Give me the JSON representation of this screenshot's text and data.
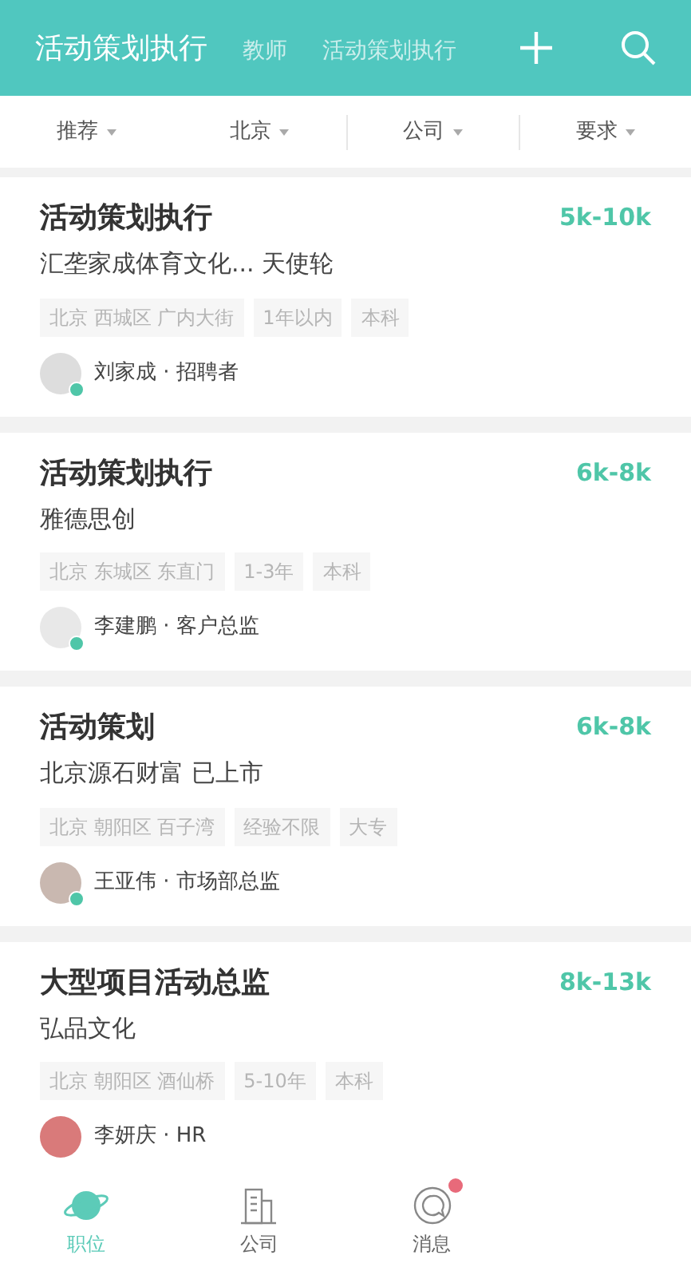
{
  "header": {
    "tabs": [
      {
        "label": "活动策划执行",
        "selected": true
      },
      {
        "label": "教师",
        "selected": false
      },
      {
        "label": "活动策划执行",
        "selected": false
      }
    ]
  },
  "filters": [
    {
      "label": "推荐"
    },
    {
      "label": "北京"
    },
    {
      "label": "公司"
    },
    {
      "label": "要求"
    }
  ],
  "jobs": [
    {
      "title": "活动策划执行",
      "salary": "5k-10k",
      "company": "汇垄家成体育文化... 天使轮",
      "tags": [
        "北京 西城区 广内大街",
        "1年以内",
        "本科"
      ],
      "recruiter": "刘家成 · 招聘者",
      "verified": true
    },
    {
      "title": "活动策划执行",
      "salary": "6k-8k",
      "company": "雅德思创",
      "tags": [
        "北京 东城区 东直门",
        "1-3年",
        "本科"
      ],
      "recruiter": "李建鹏 · 客户总监",
      "verified": true
    },
    {
      "title": "活动策划",
      "salary": "6k-8k",
      "company": "北京源石财富 已上市",
      "tags": [
        "北京 朝阳区 百子湾",
        "经验不限",
        "大专"
      ],
      "recruiter": "王亚伟 · 市场部总监",
      "verified": true
    },
    {
      "title": "大型项目活动总监",
      "salary": "8k-13k",
      "company": "弘品文化",
      "tags": [
        "北京 朝阳区 酒仙桥",
        "5-10年",
        "本科"
      ],
      "recruiter": "李妍庆 · HR",
      "verified": false
    }
  ],
  "bottom_nav": [
    {
      "kind": "jobs",
      "label": "职位",
      "selected": true,
      "badge": false
    },
    {
      "kind": "company",
      "label": "公司",
      "selected": false,
      "badge": false
    },
    {
      "kind": "messages",
      "label": "消息",
      "selected": false,
      "badge": true
    }
  ]
}
